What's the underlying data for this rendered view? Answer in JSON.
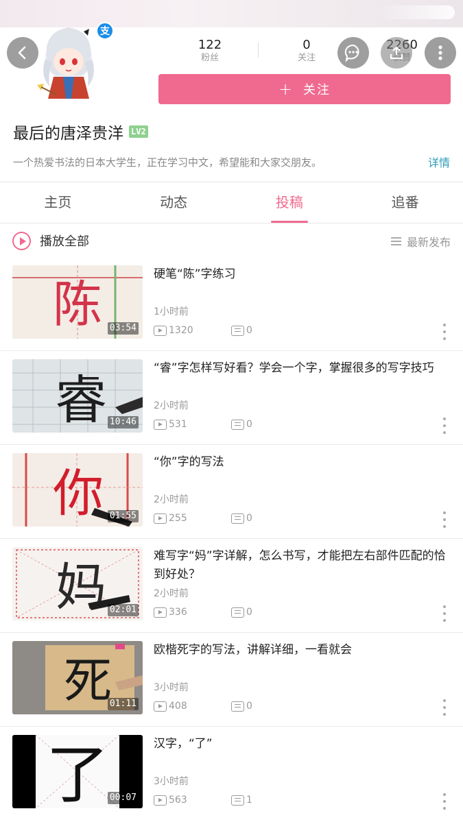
{
  "header": {
    "stats": {
      "fans": {
        "value": "122",
        "label": "粉丝"
      },
      "following": {
        "value": "0",
        "label": "关注"
      },
      "likes": {
        "value": "2260",
        "label": "获赞"
      }
    },
    "follow_button": {
      "icon": "plus",
      "label": "关注"
    }
  },
  "profile": {
    "username": "最后的唐泽贵洋",
    "level": "LV2",
    "bio": "一个热爱书法的日本大学生，正在学习中文，希望能和大家交朋友。",
    "details_link": "详情"
  },
  "tabs": [
    {
      "label": "主页",
      "active": false
    },
    {
      "label": "动态",
      "active": false
    },
    {
      "label": "投稿",
      "active": true
    },
    {
      "label": "追番",
      "active": false
    }
  ],
  "play_all": {
    "label": "播放全部",
    "sort_label": "最新发布"
  },
  "colors": {
    "accent": "#f06a8f",
    "link": "#2c9bb6",
    "muted": "#999999"
  },
  "videos": [
    {
      "title": "硬笔“陈”字练习",
      "duration": "03:54",
      "time": "1小时前",
      "plays": "1320",
      "danmaku": "0",
      "glyph": "陈"
    },
    {
      "title": "“睿”字怎样写好看？学会一个字，掌握很多的写字技巧",
      "duration": "10:46",
      "time": "2小时前",
      "plays": "531",
      "danmaku": "0",
      "glyph": "睿"
    },
    {
      "title": "“你”字的写法",
      "duration": "01:55",
      "time": "2小时前",
      "plays": "255",
      "danmaku": "0",
      "glyph": "你"
    },
    {
      "title": "难写字“妈”字详解，怎么书写，才能把左右部件匹配的恰到好处？",
      "duration": "02:01",
      "time": "2小时前",
      "plays": "336",
      "danmaku": "0",
      "glyph": "妈"
    },
    {
      "title": "欧楷死字的写法，讲解详细，一看就会",
      "duration": "01:11",
      "time": "3小时前",
      "plays": "408",
      "danmaku": "0",
      "glyph": "死"
    },
    {
      "title": "汉字，“了”",
      "duration": "00:07",
      "time": "3小时前",
      "plays": "563",
      "danmaku": "1",
      "glyph": "了"
    }
  ]
}
